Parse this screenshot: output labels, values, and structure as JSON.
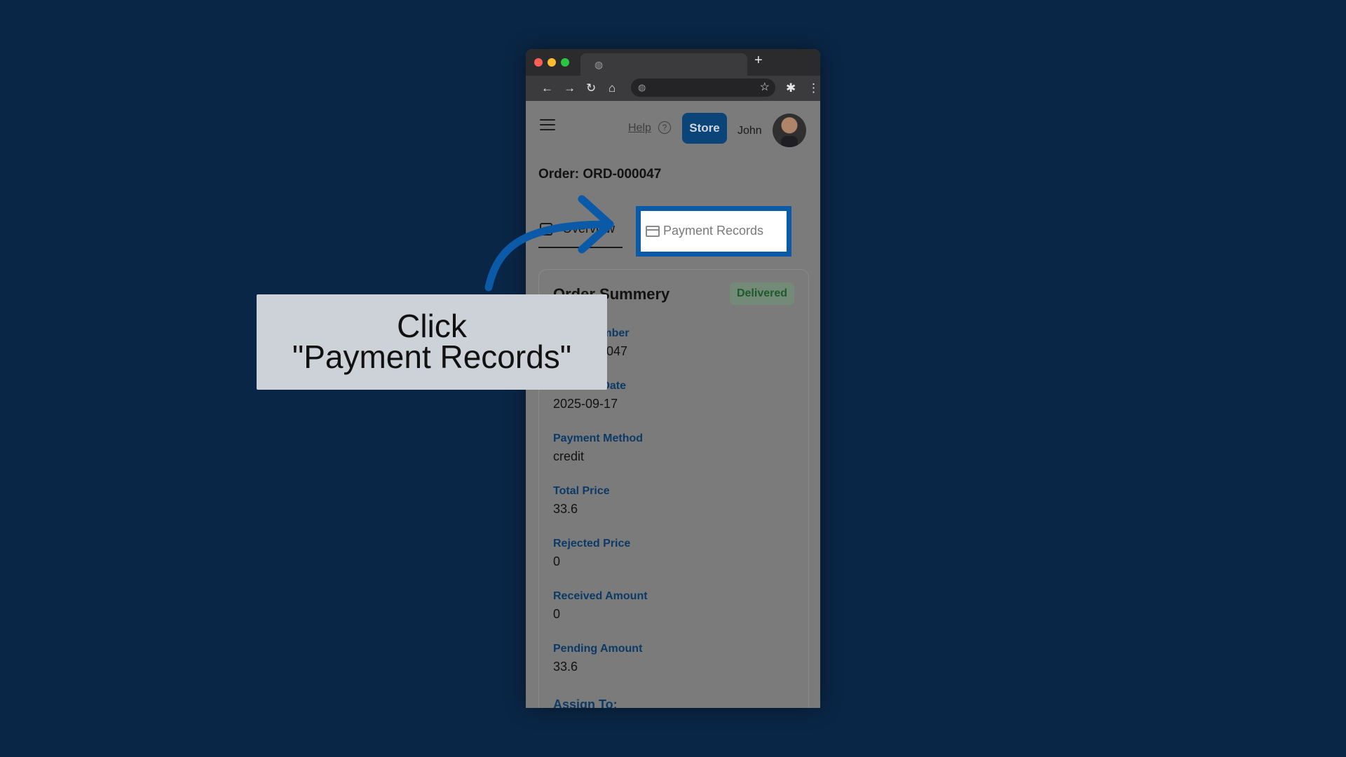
{
  "header": {
    "help_label": "Help",
    "help_icon": "?",
    "store_label": "Store",
    "user_name": "John"
  },
  "order": {
    "title": "Order: ORD-000047"
  },
  "tabs": {
    "overview": "Overview",
    "payment_records": "Payment Records"
  },
  "summary": {
    "title": "Order Summery",
    "status": "Delivered",
    "fields": [
      {
        "label": "Order Number",
        "value": "ORD-000047"
      },
      {
        "label": "Creation Date",
        "value": "2025-09-17"
      },
      {
        "label": "Payment Method",
        "value": "credit"
      },
      {
        "label": "Total Price",
        "value": "33.6"
      },
      {
        "label": "Rejected Price",
        "value": "0"
      },
      {
        "label": "Received Amount",
        "value": "0"
      },
      {
        "label": "Pending Amount",
        "value": "33.6"
      }
    ],
    "assign_label": "Assign To:"
  },
  "callout": {
    "line1": "Click",
    "line2": "\"Payment Records\""
  },
  "colors": {
    "background": "#0a2646",
    "highlight": "#0a5aa8",
    "store_button": "#0a4478"
  }
}
